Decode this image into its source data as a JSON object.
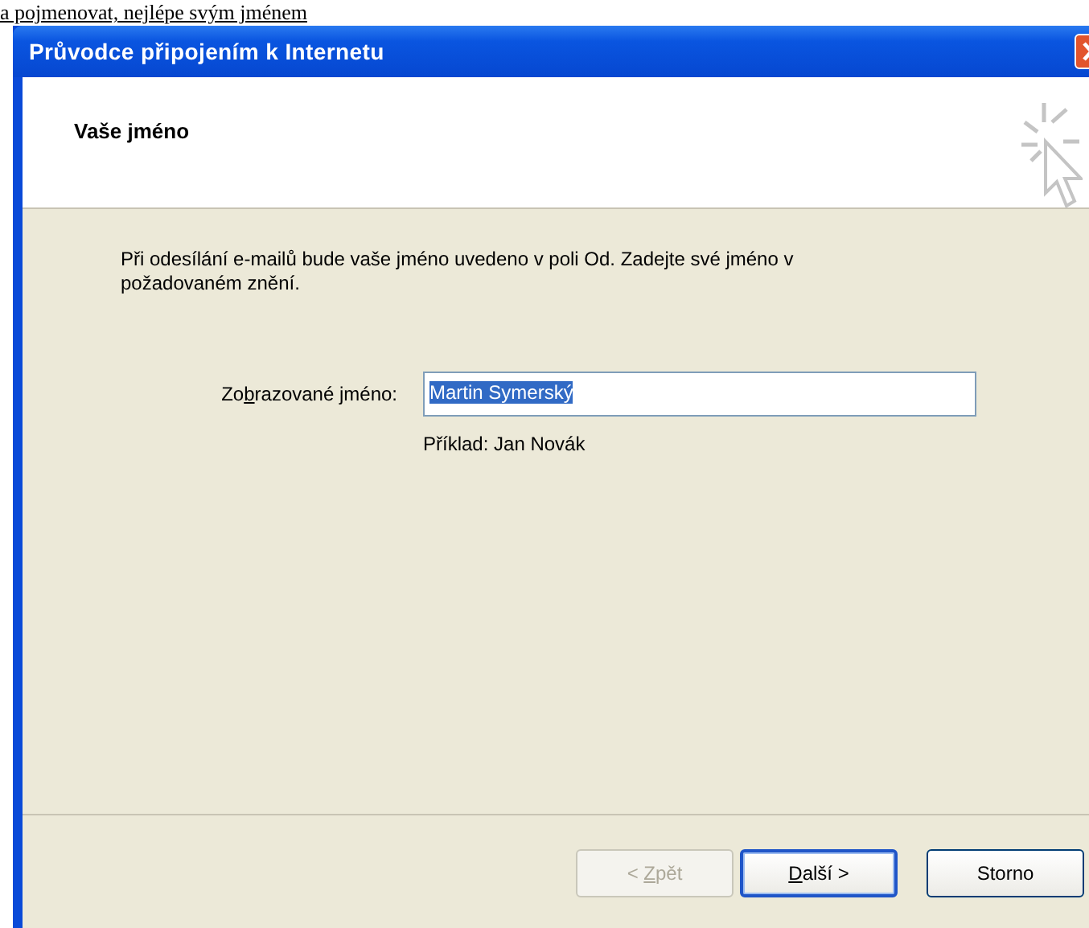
{
  "page_text": "a pojmenovat, nejlépe svým jménem",
  "window": {
    "title": "Průvodce připojením k Internetu"
  },
  "header": {
    "title": "Vaše jméno"
  },
  "intro": "Při odesílání e-mailů bude vaše jméno uvedeno v poli Od. Zadejte své jméno v požadovaném znění.",
  "name_field": {
    "label": {
      "before": "Zo",
      "access_key": "b",
      "after": "razované jméno:"
    },
    "value": "Martin Symerský",
    "selected": true
  },
  "example": "Příklad: Jan Novák",
  "buttons": [
    {
      "before": "< ",
      "access_key": "Z",
      "after": "pět",
      "disabled": true,
      "default": false
    },
    {
      "access_key": "D",
      "after": "alší >",
      "disabled": false,
      "default": true
    },
    {
      "before": "Storno",
      "disabled": false,
      "default": false
    }
  ]
}
